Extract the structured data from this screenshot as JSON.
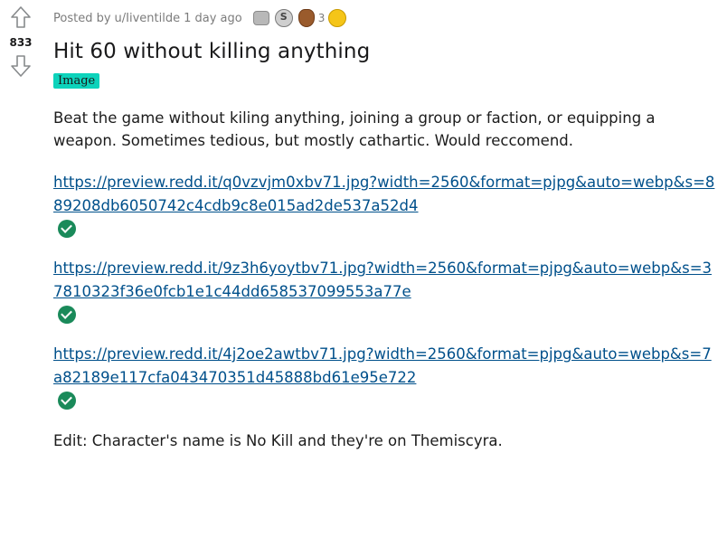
{
  "vote": {
    "score": "833"
  },
  "meta": {
    "posted_by": "Posted by",
    "username": "u/Iiventilde",
    "age": "1 day ago",
    "award_count": "3",
    "award_s_label": "S"
  },
  "post": {
    "title": "Hit 60 without killing anything",
    "flair": "Image",
    "body": "Beat the game without kiling anything, joining a group or faction, or equipping a weapon. Sometimes tedious, but mostly cathartic. Would reccomend.",
    "links": [
      "https://preview.redd.it/q0vzvjm0xbv71.jpg?width=2560&format=pjpg&auto=webp&s=889208db6050742c4cdb9c8e015ad2de537a52d4",
      "https://preview.redd.it/9z3h6yoytbv71.jpg?width=2560&format=pjpg&auto=webp&s=37810323f36e0fcb1e1c44dd658537099553a77e",
      "https://preview.redd.it/4j2oe2awtbv71.jpg?width=2560&format=pjpg&auto=webp&s=7a82189e117cfa043470351d45888bd61e95e722"
    ],
    "edit": "Edit: Character's name is No Kill and they're on Themiscyra."
  }
}
